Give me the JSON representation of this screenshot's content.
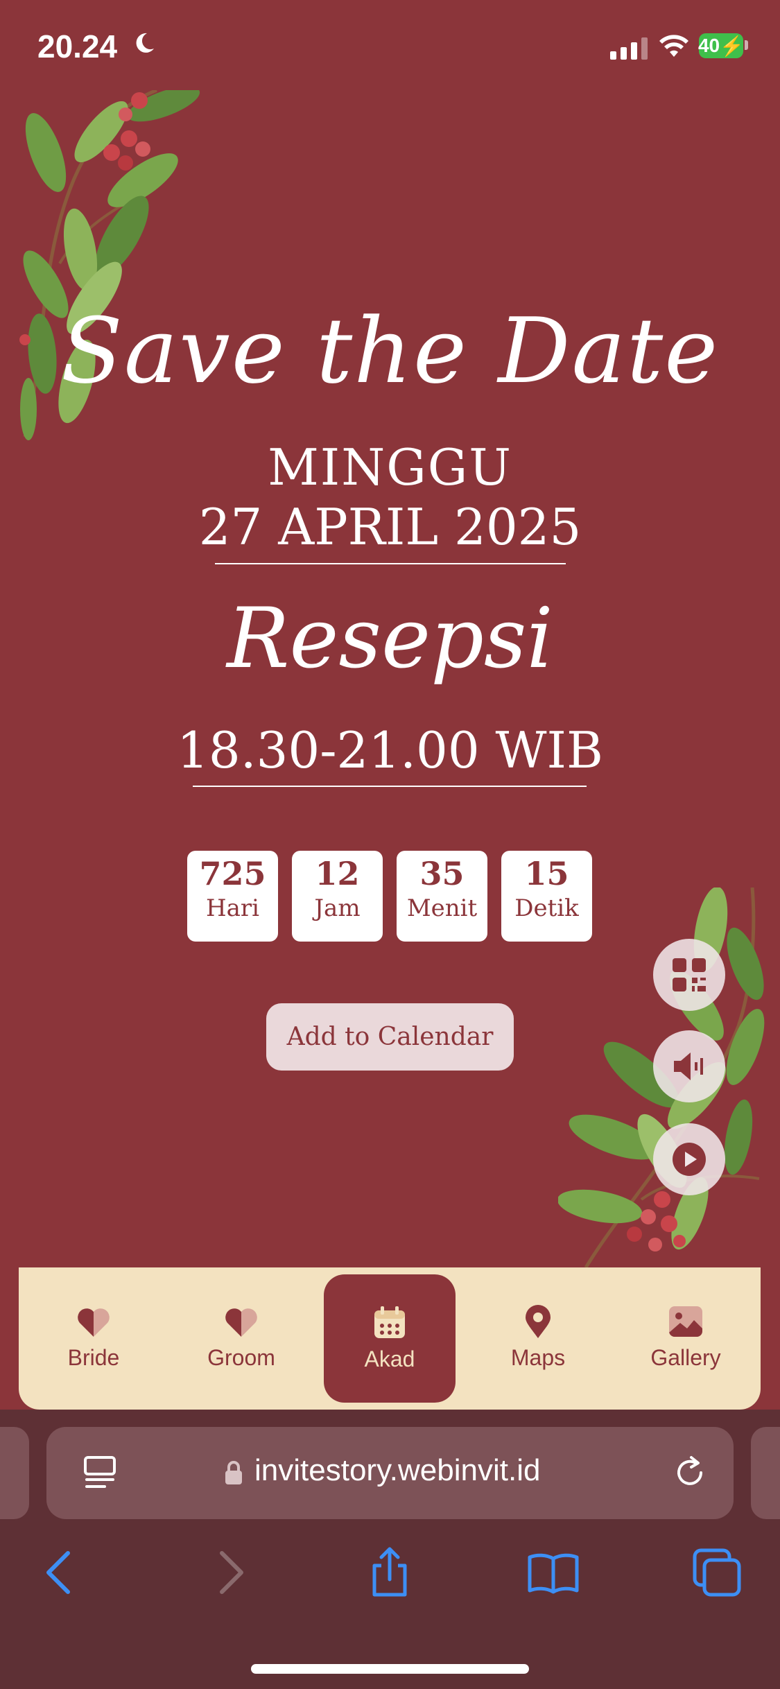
{
  "status_bar": {
    "time": "20.24",
    "battery": "40"
  },
  "invitation": {
    "title": "Save the Date",
    "day": "MINGGU",
    "date": "27 APRIL 2025",
    "event": "Resepsi",
    "time": "18.30-21.00 WIB"
  },
  "countdown": [
    {
      "value": "725",
      "label": "Hari"
    },
    {
      "value": "12",
      "label": "Jam"
    },
    {
      "value": "35",
      "label": "Menit"
    },
    {
      "value": "15",
      "label": "Detik"
    }
  ],
  "add_to_calendar_label": "Add to Calendar",
  "bottom_nav": [
    {
      "label": "Bride",
      "icon": "heart-half-icon"
    },
    {
      "label": "Groom",
      "icon": "heart-half-icon"
    },
    {
      "label": "Akad",
      "icon": "calendar-icon",
      "active": true
    },
    {
      "label": "Maps",
      "icon": "map-pin-icon"
    },
    {
      "label": "Gallery",
      "icon": "image-icon"
    }
  ],
  "browser": {
    "url": "invitestory.webinvit.id"
  },
  "colors": {
    "background": "#8b353a",
    "nav_bg": "#f3e2c0",
    "accent": "#8b353a",
    "link_blue": "#3d8ff5"
  }
}
